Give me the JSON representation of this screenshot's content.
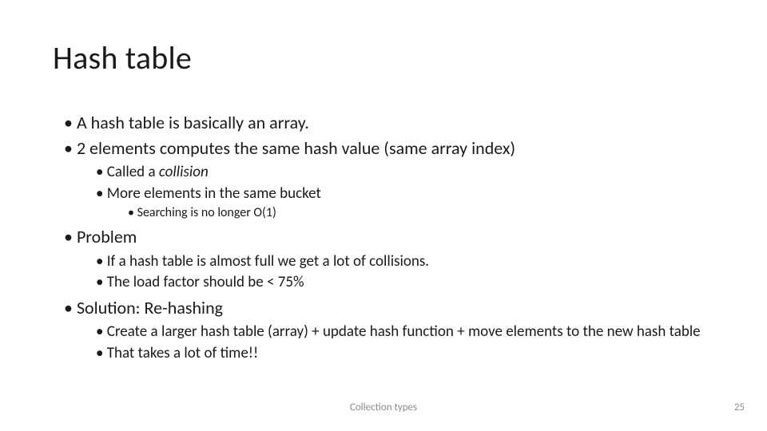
{
  "title": "Hash table",
  "b1": "A hash table is basically an array.",
  "b2": "2 elements computes the same hash value (same array index)",
  "b2a_pre": "Called a ",
  "b2a_em": "collision",
  "b2b": "More elements in the same bucket",
  "b2b1": "Searching is no longer O(1)",
  "b3": "Problem",
  "b3a": "If a hash table is almost full we get a lot of collisions.",
  "b3b": "The load factor should be < 75%",
  "b4": "Solution: Re-hashing",
  "b4a": "Create a larger hash table (array) + update hash function + move elements to the new hash table",
  "b4b": "That takes a lot of time!!",
  "footer_center": "Collection types",
  "footer_right": "25"
}
